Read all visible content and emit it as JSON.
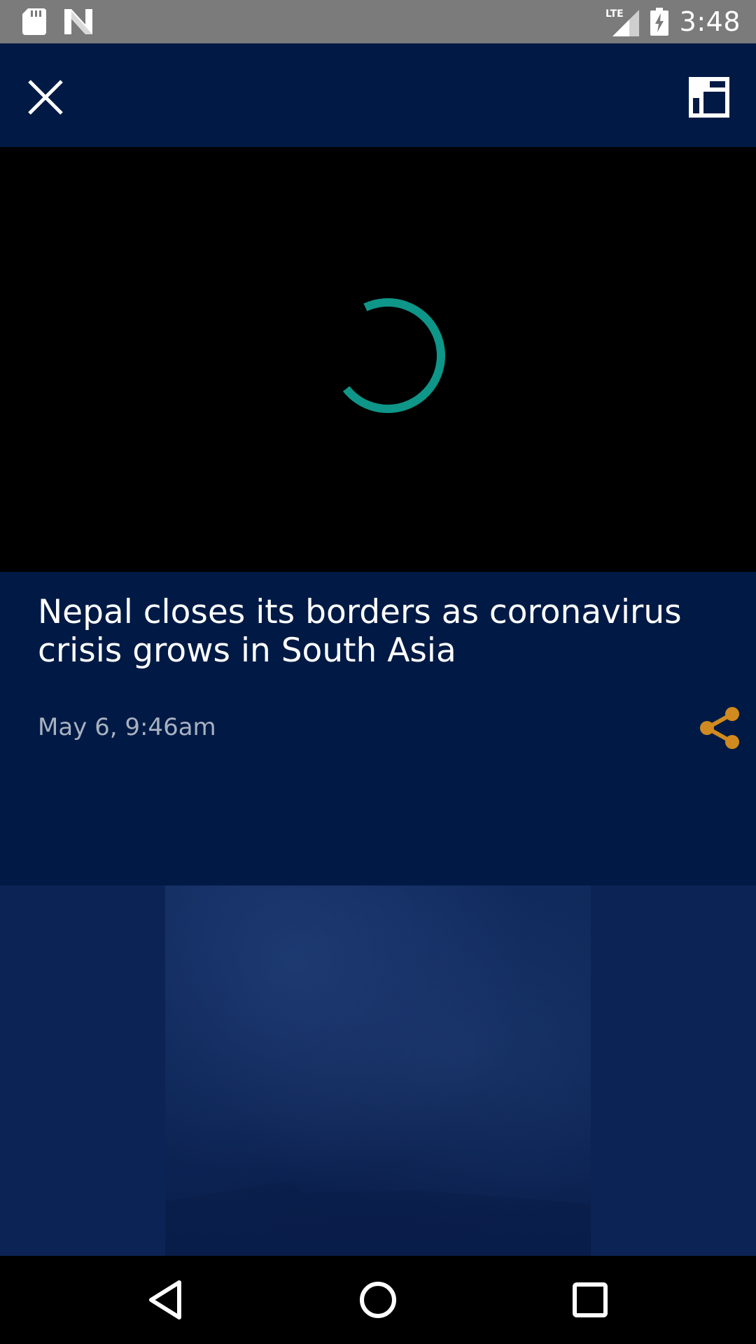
{
  "status_bar": {
    "time": "3:48",
    "network_label": "LTE",
    "icons": [
      "sd-card-icon",
      "n-notification-icon",
      "lte-signal-icon",
      "battery-charging-icon"
    ]
  },
  "toolbar": {
    "icons": [
      "close-icon",
      "picture-in-picture-icon"
    ]
  },
  "video": {
    "state": "loading",
    "spinner_color": "#0e9688"
  },
  "article": {
    "headline": "Nepal closes its borders as coronavirus crisis grows in South Asia",
    "timestamp": "May 6, 9:46am",
    "share_icon": "share-icon",
    "share_color": "#d08a1f"
  },
  "colors": {
    "header_bg": "#001a45",
    "status_bg": "#7b7b7b",
    "preview_bg": "#0c2455"
  },
  "nav_bar": {
    "icons": [
      "back-icon",
      "home-icon",
      "recents-icon"
    ]
  }
}
